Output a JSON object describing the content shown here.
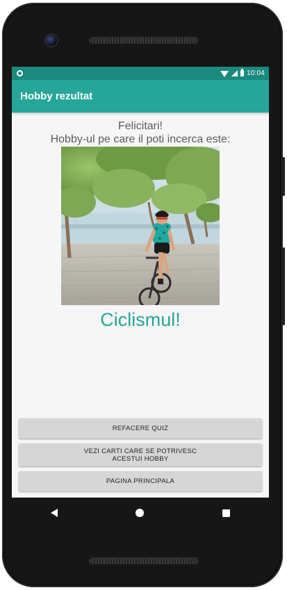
{
  "status_bar": {
    "time": "10:04",
    "icons": [
      "notification-icon",
      "wifi-icon",
      "signal-icon",
      "battery-icon"
    ]
  },
  "app_bar": {
    "title": "Hobby rezultat"
  },
  "content": {
    "congrats": "Felicitari!",
    "subtitle": "Hobby-ul pe care il poti incerca este:",
    "image_alt": "cyclist-photo",
    "result": "Ciclismul!"
  },
  "buttons": {
    "retake_quiz": "REFACERE QUIZ",
    "books": "VEZI CARTI CARE SE POTRIVESC\nACESTUI HOBBY",
    "home": "PAGINA PRINCIPALA"
  },
  "nav_bar": {
    "icons": [
      "back-icon",
      "home-icon",
      "recents-icon"
    ]
  },
  "colors": {
    "primary": "#26a69a",
    "primary_dark": "#1c8a7e",
    "button_bg": "#d6d6d6",
    "screen_bg": "#f6f6f6"
  }
}
